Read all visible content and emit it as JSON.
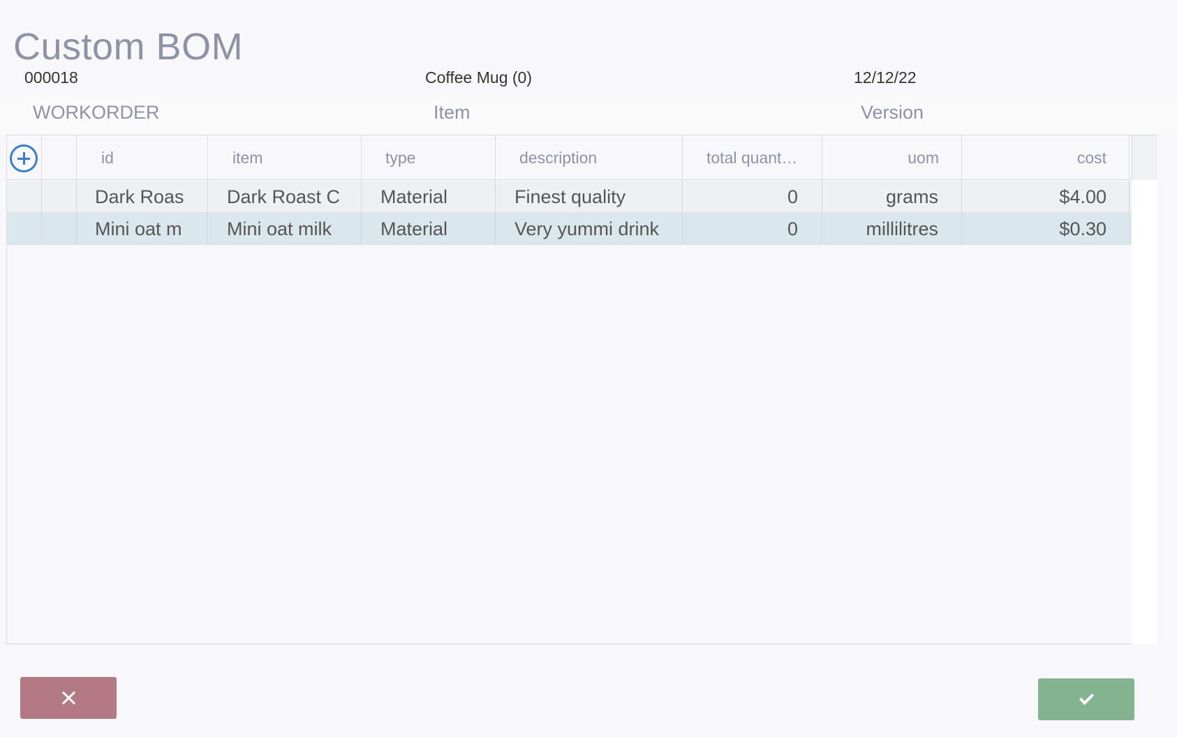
{
  "title": "Custom BOM",
  "header": {
    "workorder_value": "000018",
    "item_value": "Coffee Mug (0)",
    "version_value": "12/12/22",
    "workorder_label": "WORKORDER",
    "item_label": "Item",
    "version_label": "Version"
  },
  "grid": {
    "columns": [
      "id",
      "item",
      "type",
      "description",
      "total quant…",
      "uom",
      "cost"
    ],
    "rows": [
      {
        "id": "Dark Roast",
        "item": "Dark Roast C",
        "type": "Material",
        "description": "Finest quality",
        "total_quantity": "0",
        "uom": "grams",
        "cost": "$4.00"
      },
      {
        "id": "Mini oat m",
        "item": "Mini oat milk",
        "type": "Material",
        "description": "Very yummi drink",
        "total_quantity": "0",
        "uom": "millilitres",
        "cost": "$0.30"
      }
    ]
  },
  "icons": {
    "add": "add-circle-icon",
    "cancel": "close-icon",
    "confirm": "check-icon"
  },
  "colors": {
    "accent": "#3a7fc5",
    "cancel_button": "#b47a84",
    "confirm_button": "#84b38f",
    "selected_row": "#dae8ed"
  }
}
